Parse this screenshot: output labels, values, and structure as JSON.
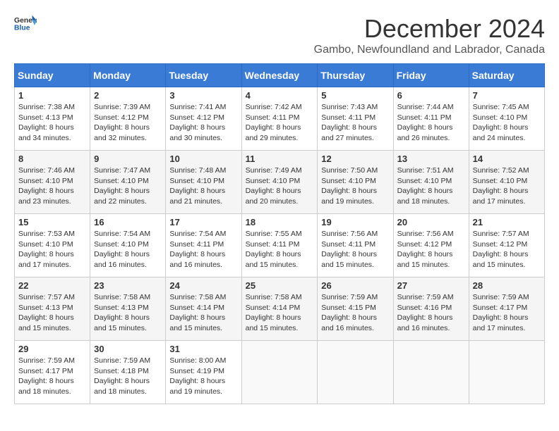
{
  "logo": {
    "line1": "General",
    "line2": "Blue"
  },
  "title": "December 2024",
  "location": "Gambo, Newfoundland and Labrador, Canada",
  "days_of_week": [
    "Sunday",
    "Monday",
    "Tuesday",
    "Wednesday",
    "Thursday",
    "Friday",
    "Saturday"
  ],
  "weeks": [
    [
      {
        "day": "1",
        "sunrise": "7:38 AM",
        "sunset": "4:13 PM",
        "daylight": "8 hours and 34 minutes."
      },
      {
        "day": "2",
        "sunrise": "7:39 AM",
        "sunset": "4:12 PM",
        "daylight": "8 hours and 32 minutes."
      },
      {
        "day": "3",
        "sunrise": "7:41 AM",
        "sunset": "4:12 PM",
        "daylight": "8 hours and 30 minutes."
      },
      {
        "day": "4",
        "sunrise": "7:42 AM",
        "sunset": "4:11 PM",
        "daylight": "8 hours and 29 minutes."
      },
      {
        "day": "5",
        "sunrise": "7:43 AM",
        "sunset": "4:11 PM",
        "daylight": "8 hours and 27 minutes."
      },
      {
        "day": "6",
        "sunrise": "7:44 AM",
        "sunset": "4:11 PM",
        "daylight": "8 hours and 26 minutes."
      },
      {
        "day": "7",
        "sunrise": "7:45 AM",
        "sunset": "4:10 PM",
        "daylight": "8 hours and 24 minutes."
      }
    ],
    [
      {
        "day": "8",
        "sunrise": "7:46 AM",
        "sunset": "4:10 PM",
        "daylight": "8 hours and 23 minutes."
      },
      {
        "day": "9",
        "sunrise": "7:47 AM",
        "sunset": "4:10 PM",
        "daylight": "8 hours and 22 minutes."
      },
      {
        "day": "10",
        "sunrise": "7:48 AM",
        "sunset": "4:10 PM",
        "daylight": "8 hours and 21 minutes."
      },
      {
        "day": "11",
        "sunrise": "7:49 AM",
        "sunset": "4:10 PM",
        "daylight": "8 hours and 20 minutes."
      },
      {
        "day": "12",
        "sunrise": "7:50 AM",
        "sunset": "4:10 PM",
        "daylight": "8 hours and 19 minutes."
      },
      {
        "day": "13",
        "sunrise": "7:51 AM",
        "sunset": "4:10 PM",
        "daylight": "8 hours and 18 minutes."
      },
      {
        "day": "14",
        "sunrise": "7:52 AM",
        "sunset": "4:10 PM",
        "daylight": "8 hours and 17 minutes."
      }
    ],
    [
      {
        "day": "15",
        "sunrise": "7:53 AM",
        "sunset": "4:10 PM",
        "daylight": "8 hours and 17 minutes."
      },
      {
        "day": "16",
        "sunrise": "7:54 AM",
        "sunset": "4:10 PM",
        "daylight": "8 hours and 16 minutes."
      },
      {
        "day": "17",
        "sunrise": "7:54 AM",
        "sunset": "4:11 PM",
        "daylight": "8 hours and 16 minutes."
      },
      {
        "day": "18",
        "sunrise": "7:55 AM",
        "sunset": "4:11 PM",
        "daylight": "8 hours and 15 minutes."
      },
      {
        "day": "19",
        "sunrise": "7:56 AM",
        "sunset": "4:11 PM",
        "daylight": "8 hours and 15 minutes."
      },
      {
        "day": "20",
        "sunrise": "7:56 AM",
        "sunset": "4:12 PM",
        "daylight": "8 hours and 15 minutes."
      },
      {
        "day": "21",
        "sunrise": "7:57 AM",
        "sunset": "4:12 PM",
        "daylight": "8 hours and 15 minutes."
      }
    ],
    [
      {
        "day": "22",
        "sunrise": "7:57 AM",
        "sunset": "4:13 PM",
        "daylight": "8 hours and 15 minutes."
      },
      {
        "day": "23",
        "sunrise": "7:58 AM",
        "sunset": "4:13 PM",
        "daylight": "8 hours and 15 minutes."
      },
      {
        "day": "24",
        "sunrise": "7:58 AM",
        "sunset": "4:14 PM",
        "daylight": "8 hours and 15 minutes."
      },
      {
        "day": "25",
        "sunrise": "7:58 AM",
        "sunset": "4:14 PM",
        "daylight": "8 hours and 15 minutes."
      },
      {
        "day": "26",
        "sunrise": "7:59 AM",
        "sunset": "4:15 PM",
        "daylight": "8 hours and 16 minutes."
      },
      {
        "day": "27",
        "sunrise": "7:59 AM",
        "sunset": "4:16 PM",
        "daylight": "8 hours and 16 minutes."
      },
      {
        "day": "28",
        "sunrise": "7:59 AM",
        "sunset": "4:17 PM",
        "daylight": "8 hours and 17 minutes."
      }
    ],
    [
      {
        "day": "29",
        "sunrise": "7:59 AM",
        "sunset": "4:17 PM",
        "daylight": "8 hours and 18 minutes."
      },
      {
        "day": "30",
        "sunrise": "7:59 AM",
        "sunset": "4:18 PM",
        "daylight": "8 hours and 18 minutes."
      },
      {
        "day": "31",
        "sunrise": "8:00 AM",
        "sunset": "4:19 PM",
        "daylight": "8 hours and 19 minutes."
      },
      null,
      null,
      null,
      null
    ]
  ]
}
